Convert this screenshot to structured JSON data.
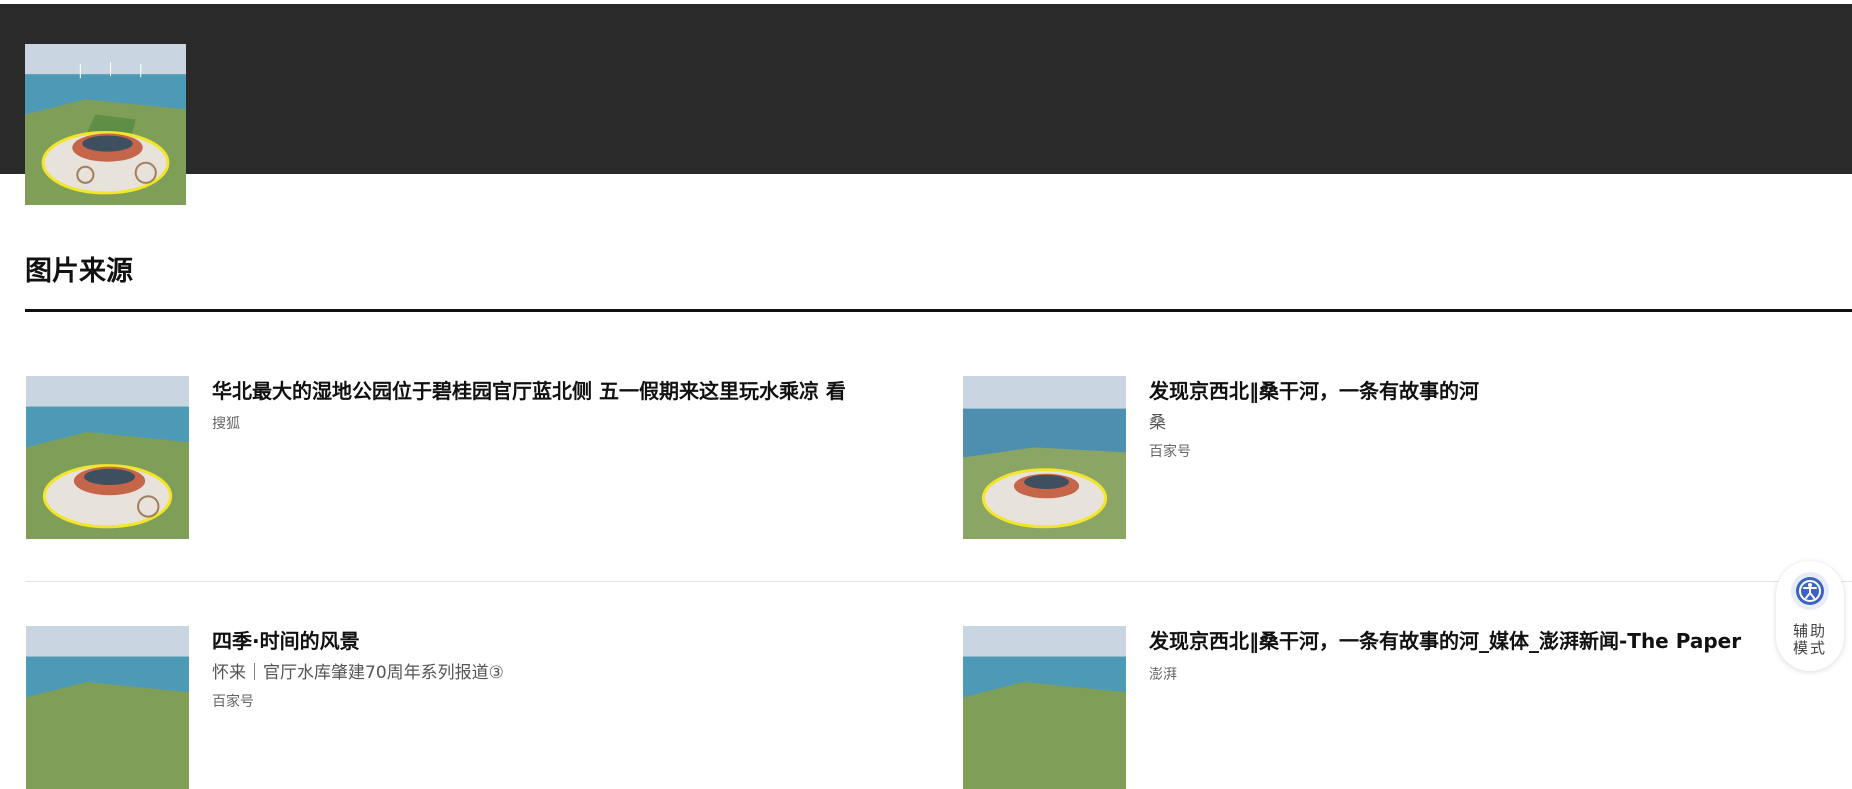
{
  "section": {
    "title": "图片来源"
  },
  "results": [
    {
      "title": "华北最大的湿地公园位于碧桂园官厅蓝北侧 五一假期来这里玩水乘凉 看",
      "subtitle": "",
      "source": "搜狐"
    },
    {
      "title": "发现京西北‖桑干河，一条有故事的河",
      "subtitle": "桑",
      "source": "百家号"
    },
    {
      "title": "四季·时间的风景",
      "subtitle": "怀来｜官厅水库肇建70周年系列报道③",
      "source": "百家号"
    },
    {
      "title": "发现京西北‖桑干河，一条有故事的河_媒体_澎湃新闻-The Paper",
      "subtitle": "",
      "source": "澎湃"
    }
  ],
  "assist": {
    "label": "辅助模式",
    "icon": "accessibility-icon"
  },
  "colors": {
    "header_bg": "#2a2a2a",
    "text": "#111111",
    "rule": "#111111"
  }
}
